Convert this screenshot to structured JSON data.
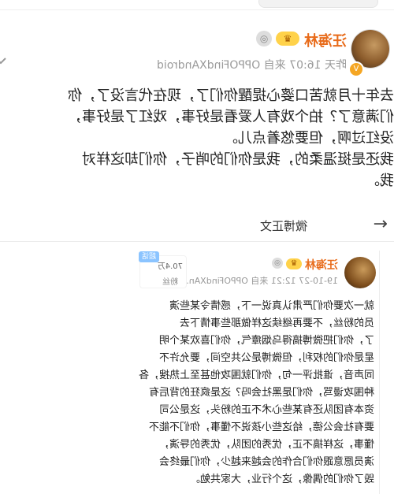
{
  "outer": {
    "author": {
      "name": "汪海林",
      "meta": "昨天 16:07  来自 OPPOFindXAndroid"
    },
    "post_lines": [
      "去年十月就苦口婆心提醒你们了，现在代言没了，你",
      "们满意了？拍个戏有人爱看是好事，戏红了是好事，",
      "没红过啊，但要悠着点儿。",
      "我还是挺温柔的，我是你们的哨子，你们却这样对",
      "我。"
    ],
    "inner_header": {
      "title": "微博正文",
      "back_glyph": "←"
    }
  },
  "embedded": {
    "author": {
      "name": "汪海林",
      "meta": "19-10-27 12:21  来自 OPPOFindXAn..."
    },
    "follow": {
      "count": "70.4万",
      "label": "粉丝",
      "tag": "超话"
    },
    "body_lines": [
      "就一次要你们严肃认真说一下，感情令某些演",
      "员的粉丝，不要再继续这样做那些事情下去",
      "了，你们把微博搞得乌烟瘴气，你们喜欢某个明",
      "星是你们的权利，但微博是公共空间，要允许不",
      "同声音，谁批评一句，你们就围攻他甚至上热搜，各",
      "种围攻谩骂，你们是黑社会吗？这是疯狂的背后有",
      "资本有团队还有某些心术不正的粉头，这是公司",
      "要有社会公德，给这些小孩说不懂事，你们不能不",
      "懂事，这样搞不正，优秀的团队，优秀的导演，",
      "演员愿意跟你们合作的会越来越少，你们最终会",
      "毁了你们的偶像，这个行业，大家共勉。"
    ]
  }
}
